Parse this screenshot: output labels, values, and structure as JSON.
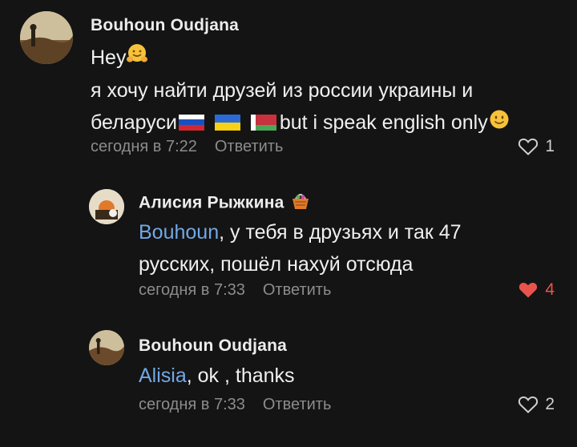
{
  "comments": [
    {
      "author": "Bouhoun Oudjana",
      "line1": "Hey",
      "line2": "я хочу найти друзей из россии украины и",
      "line3_start": "беларуси",
      "line3_end": "but i speak english only",
      "time": "сегодня в 7:22",
      "reply_label": "Ответить",
      "likes": "1"
    },
    {
      "author": "Алисия Рыжкина",
      "mention": "Bouhoun",
      "line1_rest": ", у тебя в друзьях и так 47",
      "line2": "русских, пошёл нахуй отсюда",
      "time": "сегодня в 7:33",
      "reply_label": "Ответить",
      "likes": "4"
    },
    {
      "author": "Bouhoun Oudjana",
      "mention": "Alisia",
      "line1_rest": ", ok , thanks",
      "time": "сегодня в 7:33",
      "reply_label": "Ответить",
      "likes": "2"
    }
  ],
  "colors": {
    "background": "#141414",
    "mention": "#71a8e6",
    "liked": "#e8544d",
    "meta": "#8c8c8c"
  },
  "icons": [
    "heart-outline-icon",
    "heart-filled-icon",
    "hugging-face-emoji",
    "smiling-face-emoji",
    "basket-emoji",
    "flag-russia",
    "flag-ukraine",
    "flag-belarus"
  ]
}
